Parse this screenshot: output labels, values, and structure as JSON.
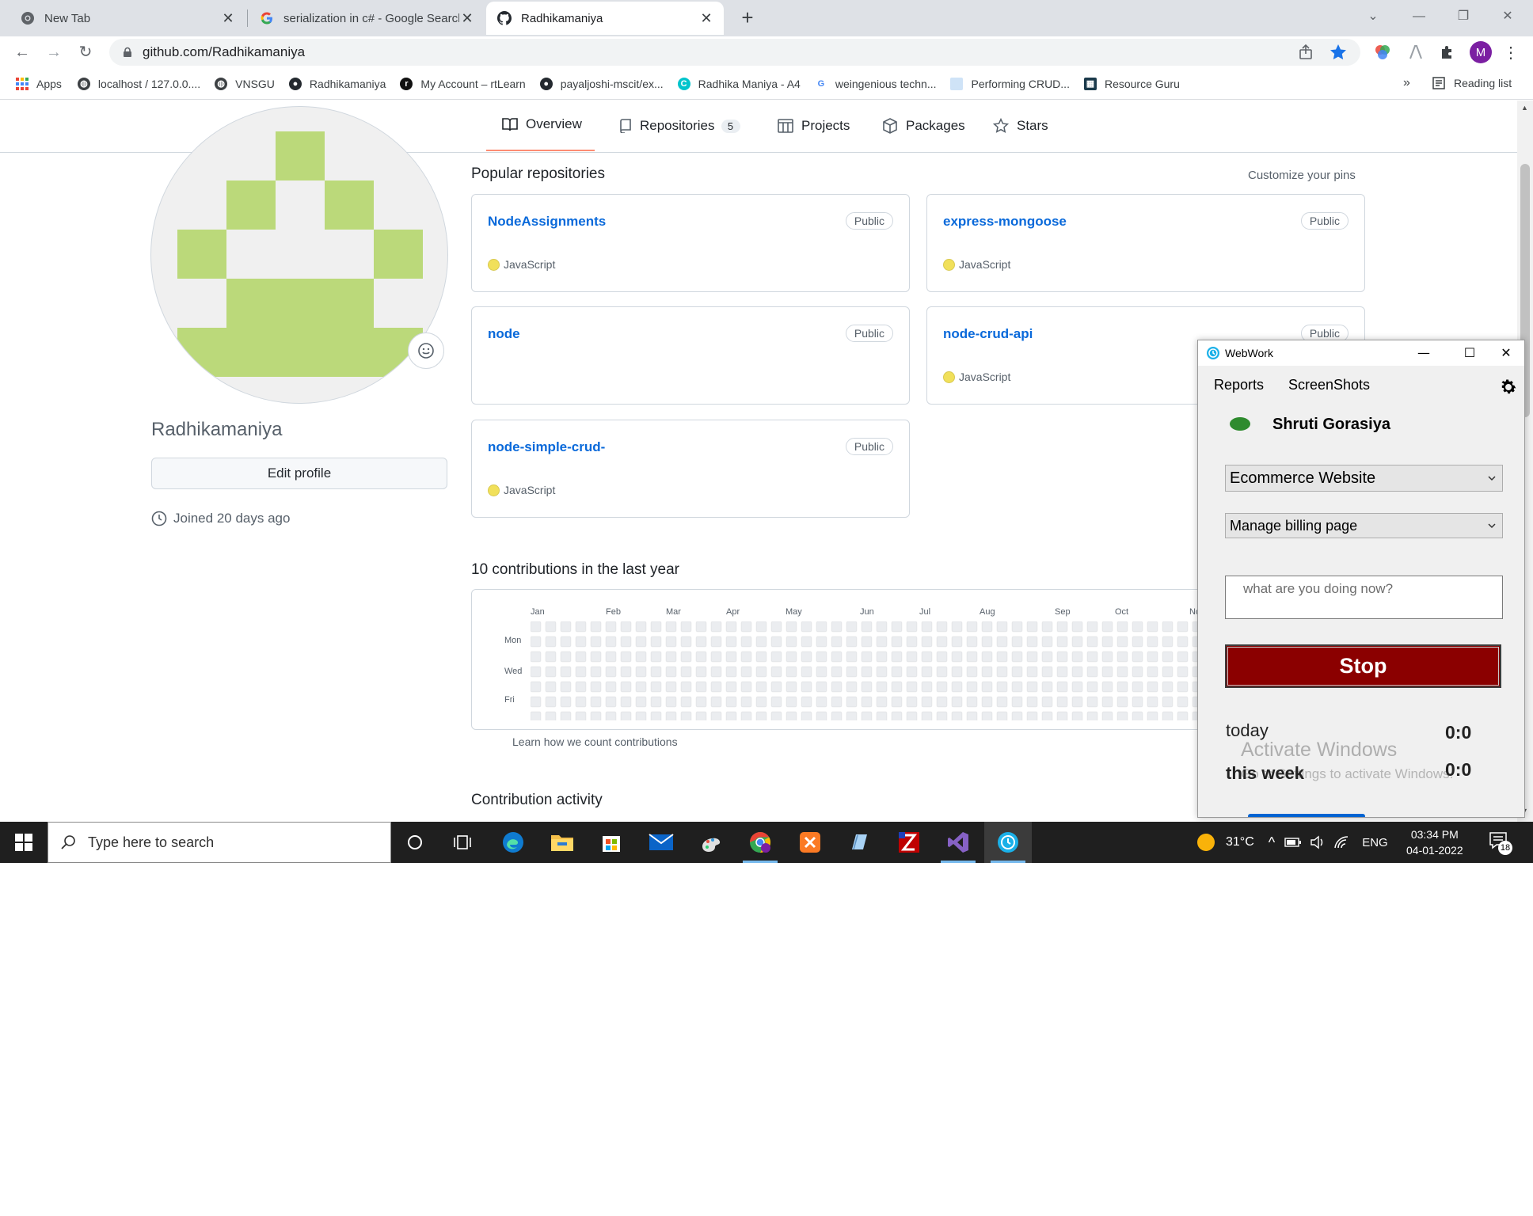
{
  "browser": {
    "tabs": [
      {
        "title": "New Tab",
        "icon": "chrome-icon"
      },
      {
        "title": "serialization in c# - Google Search",
        "icon": "google-icon"
      },
      {
        "title": "Radhikamaniya",
        "icon": "github-icon",
        "active": true
      }
    ],
    "url": "github.com/Radhikamaniya",
    "profile_initial": "M",
    "bookmarks": [
      {
        "label": "Apps",
        "icon": "apps-grid-icon"
      },
      {
        "label": "localhost / 127.0.0....",
        "icon": "globe-icon"
      },
      {
        "label": "VNSGU",
        "icon": "globe-icon"
      },
      {
        "label": "Radhikamaniya",
        "icon": "github-icon"
      },
      {
        "label": "My Account – rtLearn",
        "icon": "rtlearn-icon"
      },
      {
        "label": "payaljoshi-mscit/ex...",
        "icon": "github-icon"
      },
      {
        "label": "Radhika Maniya - A4",
        "icon": "canva-icon"
      },
      {
        "label": "weingenious techn...",
        "icon": "google-icon"
      },
      {
        "label": "Performing CRUD...",
        "icon": "page-icon"
      },
      {
        "label": "Resource Guru",
        "icon": "resource-guru-icon"
      }
    ],
    "bookmarks_overflow": "»",
    "reading_list": "Reading list"
  },
  "github": {
    "nav_tabs": [
      {
        "label": "Overview",
        "icon": "book-icon",
        "selected": true
      },
      {
        "label": "Repositories",
        "icon": "repo-icon",
        "count": "5"
      },
      {
        "label": "Projects",
        "icon": "project-icon"
      },
      {
        "label": "Packages",
        "icon": "package-icon"
      },
      {
        "label": "Stars",
        "icon": "star-icon"
      }
    ],
    "username": "Radhikamaniya",
    "edit_profile": "Edit profile",
    "joined": "Joined 20 days ago",
    "popular_title": "Popular repositories",
    "customize": "Customize your pins",
    "repos": [
      {
        "name": "NodeAssignments",
        "visibility": "Public",
        "language": "JavaScript"
      },
      {
        "name": "express-mongoose",
        "visibility": "Public",
        "language": "JavaScript"
      },
      {
        "name": "node",
        "visibility": "Public",
        "language": ""
      },
      {
        "name": "node-crud-api",
        "visibility": "Public",
        "language": "JavaScript"
      },
      {
        "name": "node-simple-crud-",
        "visibility": "Public",
        "language": "JavaScript"
      }
    ],
    "language_color": "#f1e05a",
    "contributions_title": "10 contributions in the last year",
    "months": [
      "Jan",
      "Feb",
      "Mar",
      "Apr",
      "May",
      "Jun",
      "Jul",
      "Aug",
      "Sep",
      "Oct",
      "Nc"
    ],
    "weekdays": [
      "Mon",
      "Wed",
      "Fri"
    ],
    "learn": "Learn how we count contributions",
    "activity_title": "Contribution activity"
  },
  "webwork": {
    "title": "WebWork",
    "menu": [
      "Reports",
      "ScreenShots"
    ],
    "user": "Shruti Gorasiya",
    "project": "Ecommerce Website",
    "task": "Manage billing page",
    "note_placeholder": "what are you doing now?",
    "stop": "Stop",
    "today_label": "today",
    "today_value": "0:0",
    "week_label": "this week",
    "week_value": "0:0",
    "watermark_title": "Activate Windows",
    "watermark_sub": "Go to Settings to activate Windows.",
    "status_color": "#2e8b2e",
    "stop_color": "#8b0000"
  },
  "taskbar": {
    "search_placeholder": "Type here to search",
    "weather": "31°C",
    "language": "ENG",
    "time": "03:34 PM",
    "date": "04-01-2022",
    "notifications": "18"
  }
}
